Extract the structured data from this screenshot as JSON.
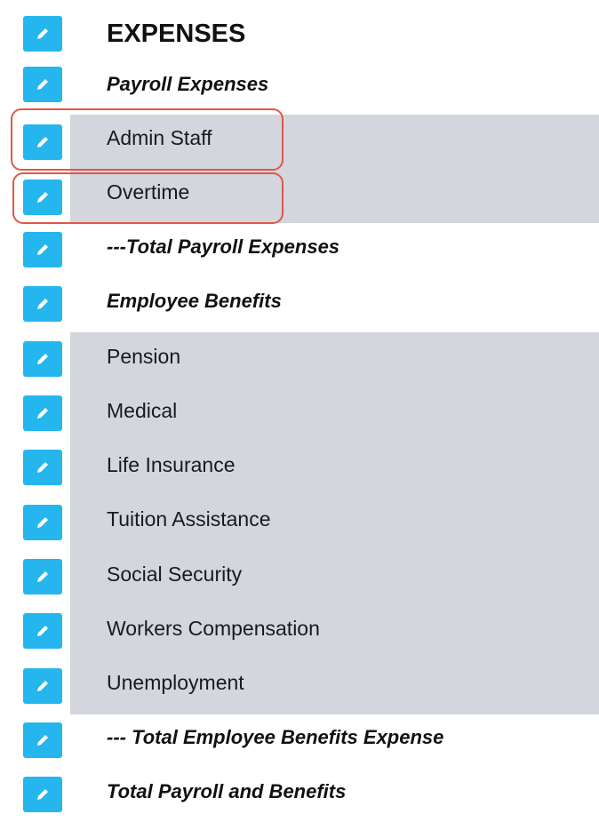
{
  "rows": [
    {
      "label": "EXPENSES",
      "style": "section",
      "shaded": false
    },
    {
      "label": "Payroll Expenses",
      "style": "head",
      "shaded": false
    },
    {
      "label": "Admin Staff",
      "style": "item",
      "shaded": true,
      "highlighted": true
    },
    {
      "label": "Overtime",
      "style": "item",
      "shaded": true,
      "highlighted": true
    },
    {
      "label": "---Total Payroll Expenses",
      "style": "head",
      "shaded": false
    },
    {
      "label": "Employee Benefits",
      "style": "head",
      "shaded": false
    },
    {
      "label": "Pension",
      "style": "item",
      "shaded": true
    },
    {
      "label": "Medical",
      "style": "item",
      "shaded": true
    },
    {
      "label": "Life Insurance",
      "style": "item",
      "shaded": true
    },
    {
      "label": "Tuition Assistance",
      "style": "item",
      "shaded": true
    },
    {
      "label": "Social Security",
      "style": "item",
      "shaded": true
    },
    {
      "label": "Workers Compensation",
      "style": "item",
      "shaded": true
    },
    {
      "label": "Unemployment",
      "style": "item",
      "shaded": true
    },
    {
      "label": "--- Total Employee Benefits Expense",
      "style": "head",
      "shaded": false
    },
    {
      "label": "Total Payroll and Benefits",
      "style": "head",
      "shaded": false
    }
  ],
  "icons": {
    "edit": "pencil-icon"
  },
  "colors": {
    "edit_button": "#25b6ee",
    "row_shade": "#d3d6dd",
    "highlight_outline": "#e0584a"
  }
}
